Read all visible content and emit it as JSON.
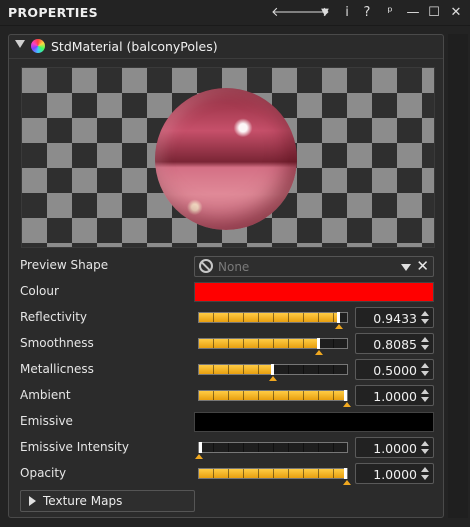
{
  "window": {
    "title": "PROPERTIES",
    "toolbar_icons": [
      "back-arrow-icon",
      "forward-arrow-icon",
      "dropdown-icon",
      "info-icon",
      "help-icon",
      "pin-icon",
      "minimize-icon",
      "maximize-icon",
      "close-icon"
    ],
    "glyphs": {
      "back": "🡐",
      "forward": "🡒",
      "dropdown": "▼",
      "info": "i",
      "help": "?",
      "pin": "ᵖ",
      "minimize": "—",
      "maximize": "☐",
      "close": "✕"
    }
  },
  "panel": {
    "title": "StdMaterial (balconyPoles)",
    "preview_shape": {
      "label": "Preview Shape",
      "value": "None",
      "clear_glyph": "✕"
    },
    "colour": {
      "label": "Colour",
      "color": "#ff0000"
    },
    "emissive": {
      "label": "Emissive",
      "color": "#000000"
    },
    "sliders": [
      {
        "label": "Reflectivity",
        "value": "0.9433",
        "fraction": 0.9433
      },
      {
        "label": "Smoothness",
        "value": "0.8085",
        "fraction": 0.8085
      },
      {
        "label": "Metallicness",
        "value": "0.5000",
        "fraction": 0.5
      },
      {
        "label": "Ambient",
        "value": "1.0000",
        "fraction": 1.0
      }
    ],
    "emissive_intensity": {
      "label": "Emissive Intensity",
      "value": "1.0000",
      "fraction": 0.0
    },
    "opacity": {
      "label": "Opacity",
      "value": "1.0000",
      "fraction": 1.0
    },
    "texture_maps": {
      "label": "Texture Maps"
    }
  },
  "colors": {
    "accent": "#f0a820",
    "background": "#232323"
  }
}
